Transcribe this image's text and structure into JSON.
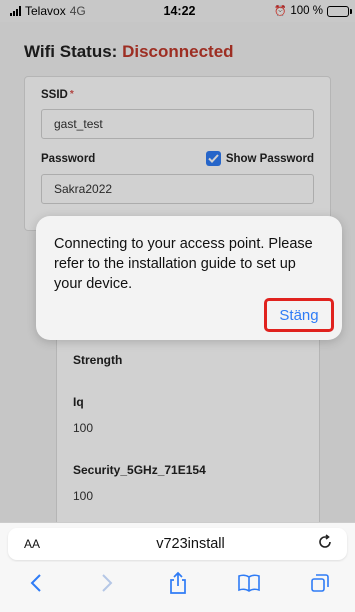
{
  "status_bar": {
    "carrier": "Telavox",
    "network": "4G",
    "time": "14:22",
    "battery": "100 %",
    "battery_color": "#4cd964"
  },
  "page": {
    "wifi_status_label": "Wifi Status:",
    "wifi_status_value": "Disconnected",
    "status_color": "#c0392b",
    "ssid_label": "SSID",
    "ssid_required_mark": "*",
    "ssid_value": "gast_test",
    "password_label": "Password",
    "show_password_label": "Show Password",
    "show_password_checked": true,
    "password_value": "Sakra2022",
    "scan_list": {
      "strength_label": "Strength",
      "iq_label": "Iq",
      "iq_value": "100",
      "network_name": "Security_5GHz_71E154",
      "network_value": "100"
    }
  },
  "alert": {
    "message": "Connecting to your access point. Please refer to the installation guide to set up your device.",
    "close_button": "Stäng",
    "highlight_color": "#e0221e",
    "accent_color": "#2f7cf6"
  },
  "browser": {
    "text_size_button": "AA",
    "url": "v723install",
    "icons": [
      "reload-icon",
      "back-icon",
      "forward-icon",
      "share-icon",
      "bookmarks-icon",
      "tabs-icon"
    ]
  }
}
